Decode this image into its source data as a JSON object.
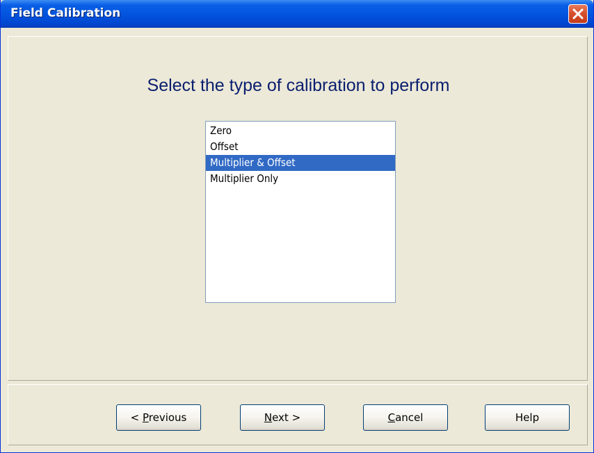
{
  "window": {
    "title": "Field Calibration"
  },
  "main": {
    "heading": "Select the type of calibration to perform",
    "calibration_types": [
      {
        "label": "Zero",
        "selected": false
      },
      {
        "label": "Offset",
        "selected": false
      },
      {
        "label": "Multiplier & Offset",
        "selected": true
      },
      {
        "label": "Multiplier Only",
        "selected": false
      }
    ]
  },
  "buttons": {
    "previous": {
      "prefix": "< ",
      "mnemonic": "P",
      "rest": "revious"
    },
    "next": {
      "mnemonic": "N",
      "rest": "ext >"
    },
    "cancel": {
      "mnemonic": "C",
      "rest": "ancel"
    },
    "help": {
      "label": "Help"
    }
  },
  "icons": {
    "close": "close-icon"
  },
  "colors": {
    "heading": "#0A1E6E",
    "selection": "#316AC5",
    "titlebar": "#0255DF",
    "close_button": "#D8522F"
  }
}
